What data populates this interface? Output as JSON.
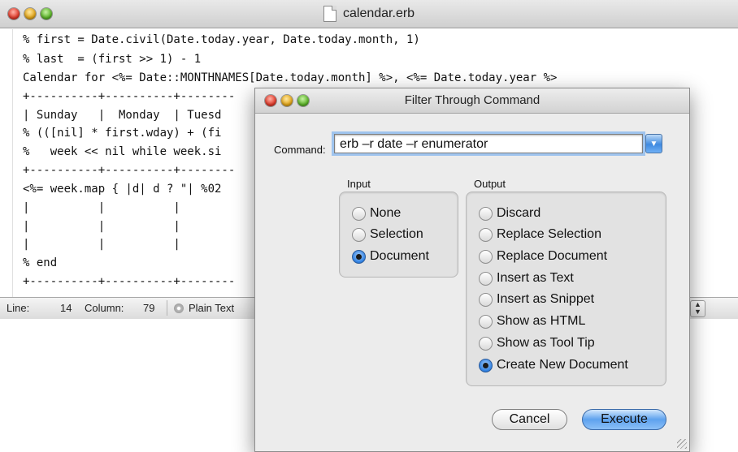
{
  "editor": {
    "title": "calendar.erb",
    "code_lines": [
      "% first = Date.civil(Date.today.year, Date.today.month, 1)",
      "% last  = (first >> 1) - 1",
      "Calendar for <%= Date::MONTHNAMES[Date.today.month] %>, <%= Date.today.year %>",
      "+----------+----------+--------",
      "| Sunday   |  Monday  | Tuesd",
      "% (([nil] * first.wday) + (fi",
      "%   week << nil while week.si",
      "+----------+----------+--------",
      "<%= week.map { |d| d ? \"| %02",
      "|          |          |",
      "|          |          |",
      "|          |          |",
      "% end",
      "+----------+----------+--------"
    ],
    "status": {
      "line_label": "Line:",
      "line_value": "14",
      "column_label": "Column:",
      "column_value": "79",
      "mode": "Plain Text"
    }
  },
  "dialog": {
    "title": "Filter Through Command",
    "command_label": "Command:",
    "command_value": "erb –r date –r enumerator",
    "input": {
      "label": "Input",
      "options": [
        "None",
        "Selection",
        "Document"
      ],
      "selected": "Document"
    },
    "output": {
      "label": "Output",
      "options": [
        "Discard",
        "Replace Selection",
        "Replace Document",
        "Insert as Text",
        "Insert as Snippet",
        "Show as HTML",
        "Show as Tool Tip",
        "Create New Document"
      ],
      "selected": "Create New Document"
    },
    "buttons": {
      "cancel": "Cancel",
      "execute": "Execute"
    }
  }
}
